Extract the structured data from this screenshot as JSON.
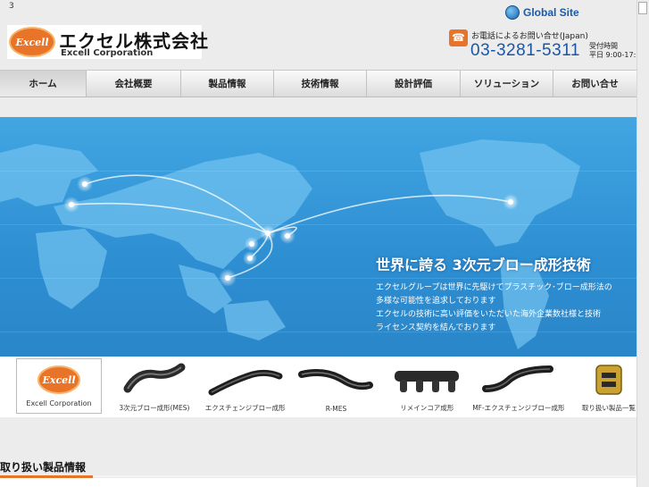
{
  "page_number": "3",
  "header": {
    "company_name_jp": "エクセル株式会社",
    "company_name_en": "Excell Corporation",
    "logo_text": "Excell",
    "global_site_label": "Global Site",
    "phone_caption": "お電話によるお問い合せ(Japan)",
    "phone_number": "03-3281-5311",
    "hours_label": "受付時間",
    "hours_value": "平日 9:00-17:"
  },
  "nav": {
    "items": [
      {
        "label": "ホーム",
        "active": true
      },
      {
        "label": "会社概要",
        "active": false
      },
      {
        "label": "製品情報",
        "active": false
      },
      {
        "label": "技術情報",
        "active": false
      },
      {
        "label": "設計評価",
        "active": false
      },
      {
        "label": "ソリューション",
        "active": false
      },
      {
        "label": "お問い合せ",
        "active": false
      }
    ]
  },
  "banner": {
    "title": "世界に誇る 3次元ブロー成形技術",
    "lines": [
      "エクセルグループは世界に先駆けてプラスチック･ブロー成形法の",
      "多様な可能性を追求しております",
      "エクセルの技術に高い評価をいただいた海外企業数社様と技術",
      "ライセンス契約を結んでおります"
    ]
  },
  "products": [
    {
      "label": "Excell Corporation",
      "icon": "excell-logo-icon"
    },
    {
      "label": "3次元ブロー成形(MES)",
      "icon": "mes-part-icon"
    },
    {
      "label": "エクスチェンジブロー成形",
      "icon": "exchange-blow-part-icon"
    },
    {
      "label": "R-MES",
      "icon": "r-mes-part-icon"
    },
    {
      "label": "リメインコア成形",
      "icon": "remain-core-part-icon"
    },
    {
      "label": "MF-エクスチェンジブロー成形",
      "icon": "mf-exchange-part-icon"
    },
    {
      "label": "取り扱い製品一覧",
      "icon": "product-list-icon"
    }
  ],
  "section": {
    "title": "取り扱い製品情報"
  },
  "colors": {
    "accent": "#e8742a",
    "brand_blue": "#1b56a4",
    "banner_blue": "#2d8ed2"
  }
}
